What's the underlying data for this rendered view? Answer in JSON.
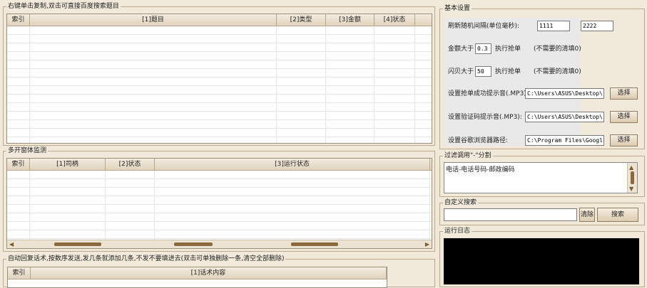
{
  "top_table": {
    "title": "右键单击复制,双击可直接百度搜索题目",
    "columns": [
      "索引",
      "[1]题目",
      "[2]类型",
      "[3]金额",
      "[4]状态"
    ]
  },
  "monitor_table": {
    "title": "多开窗体监测",
    "columns": [
      "索引",
      "[1]司柄",
      "[2]状态",
      "[3]运行状态"
    ]
  },
  "reply_table": {
    "title": "自动回复话术,按数序发送,发几条就添加几条,不发不要填进去(双击可单独删除一条,清空全部删除)",
    "columns": [
      "索引",
      "[1]话术内容"
    ]
  },
  "settings": {
    "title": "基本设置",
    "refresh_label": "刷新随机间隔(单位毫秒):",
    "refresh_min": "1111",
    "refresh_max": "2222",
    "amount_label": "金额大于",
    "amount_value": "0.3",
    "amount_action": "执行抢单",
    "amount_note": "(不需要的清填0)",
    "shell_label": "闪贝大于",
    "shell_value": "50",
    "shell_action": "执行抢单",
    "shell_note": "(不需要的清填0)",
    "success_sound_label": "设置抢单成功提示音(.MP3):",
    "success_sound_path": "C:\\Users\\ASUS\\Desktop\\黑马",
    "captcha_sound_label": "设置验证码提示音(.MP3):",
    "captcha_sound_path": "C:\\Users\\ASUS\\Desktop\\黑马",
    "chrome_label": "设置谷歌浏览器路径:",
    "chrome_path": "C:\\Program Files\\Google\\Ch",
    "choose_label": "选择"
  },
  "filter": {
    "title": "过滤调用\"-\"分割",
    "text": "电话-电话号码-邮政编码"
  },
  "search": {
    "title": "自定义搜索",
    "value": "",
    "clear_label": "清除",
    "search_label": "搜索"
  },
  "log": {
    "title": "运行日志"
  }
}
